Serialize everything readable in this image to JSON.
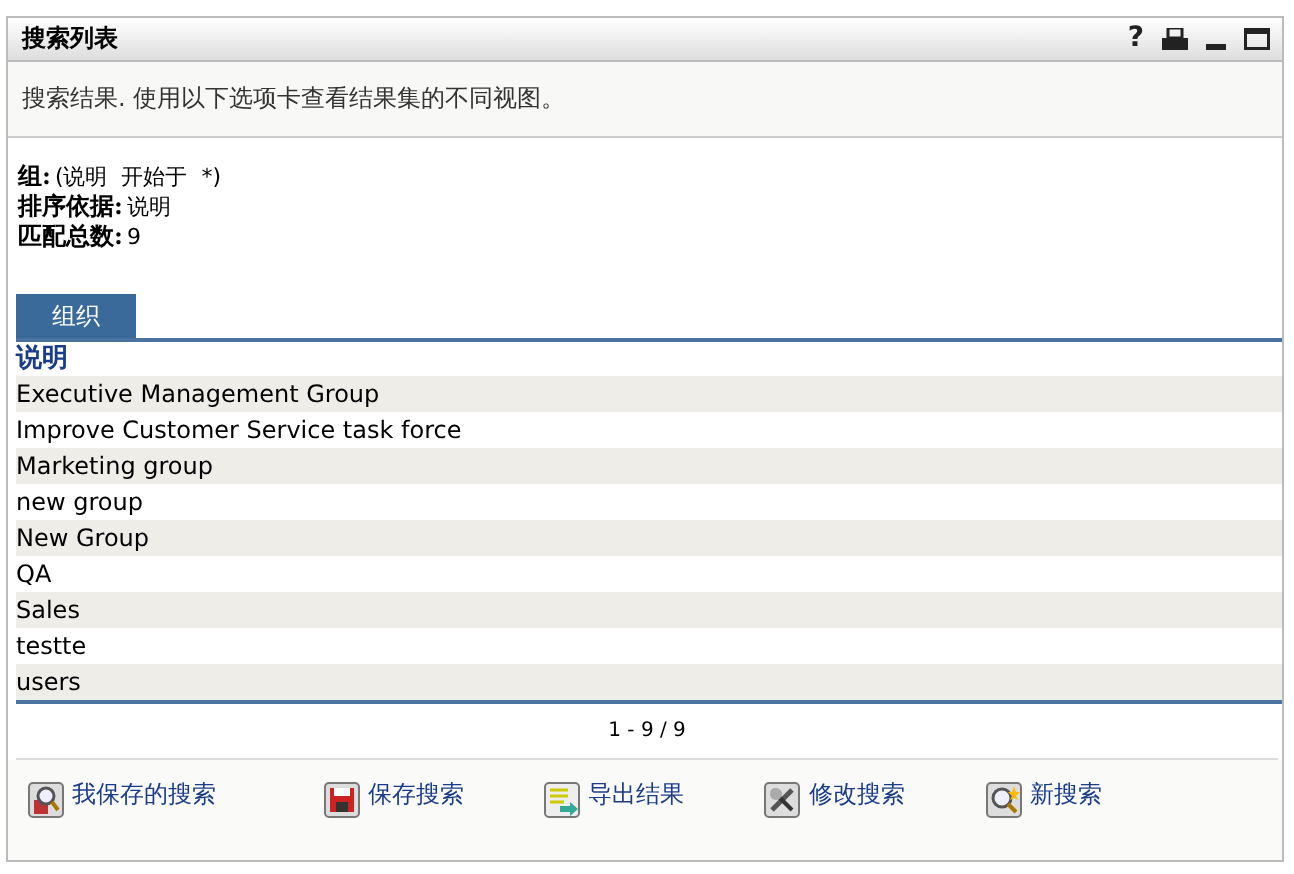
{
  "window": {
    "title": "搜索列表"
  },
  "title_icons": [
    {
      "kind": "help",
      "text": "?"
    },
    {
      "kind": "print"
    },
    {
      "kind": "minimize"
    },
    {
      "kind": "maximize"
    }
  ],
  "description": "搜索结果. 使用以下选项卡查看结果集的不同视图。",
  "criteria": [
    {
      "label": "组:",
      "value": "(说明  开始于  *)"
    },
    {
      "label": "排序依据:",
      "value": "说明"
    },
    {
      "label": "匹配总数:",
      "value": "9"
    }
  ],
  "tabs": [
    {
      "label": "组织",
      "selected": true
    }
  ],
  "table": {
    "columns": [
      "说明"
    ],
    "rows": [
      "Executive Management Group",
      "Improve Customer Service task force",
      "Marketing group",
      "new group",
      "New Group",
      "QA",
      "Sales",
      "testte",
      "users"
    ]
  },
  "pagination": "1 - 9 / 9",
  "actions": [
    {
      "kind": "saved",
      "label": "我保存的搜索"
    },
    {
      "kind": "save",
      "label": "保存搜索"
    },
    {
      "kind": "export",
      "label": "导出结果"
    },
    {
      "kind": "modify",
      "label": "修改搜索"
    },
    {
      "kind": "new",
      "label": "新搜索"
    }
  ]
}
